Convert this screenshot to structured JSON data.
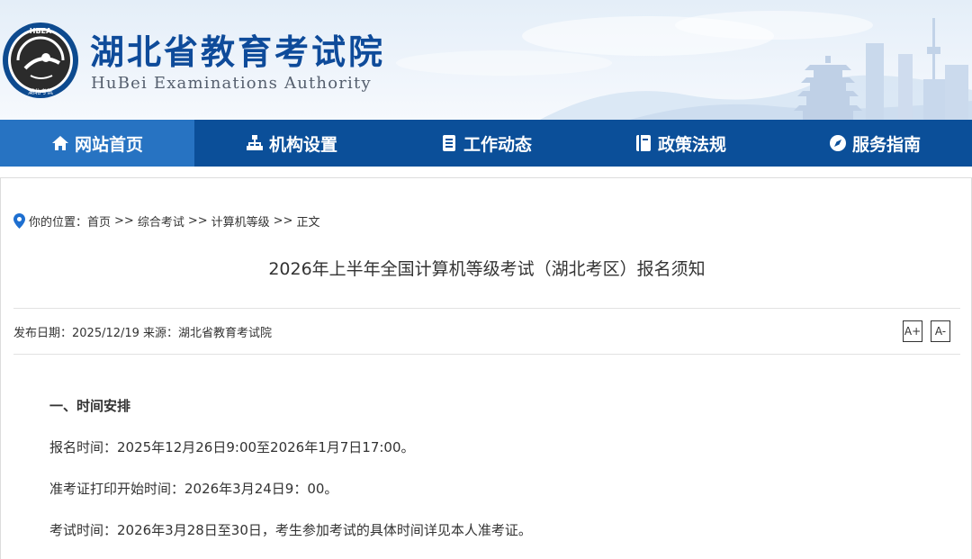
{
  "header": {
    "logo_text": "HBEA",
    "logo_subtext": "湖北考试",
    "title": "湖北省教育考试院",
    "subtitle": "HuBei Examinations Authority"
  },
  "nav": {
    "items": [
      {
        "label": "网站首页",
        "icon": "home-icon",
        "active": true
      },
      {
        "label": "机构设置",
        "icon": "org-chart-icon",
        "active": false
      },
      {
        "label": "工作动态",
        "icon": "news-icon",
        "active": false
      },
      {
        "label": "政策法规",
        "icon": "book-icon",
        "active": false
      },
      {
        "label": "服务指南",
        "icon": "compass-icon",
        "active": false
      }
    ]
  },
  "breadcrumb": {
    "prefix": "你的位置：",
    "items": [
      "首页",
      "综合考试",
      "计算机等级",
      "正文"
    ],
    "separator": ">>"
  },
  "article": {
    "title": "2026年上半年全国计算机等级考试（湖北考区）报名须知",
    "meta": "发布日期：2025/12/19 来源：湖北省教育考试院",
    "font_increase": "A+",
    "font_decrease": "A-",
    "section_heading": "一、时间安排",
    "paragraphs": [
      "报名时间：2025年12月26日9:00至2026年1月7日17:00。",
      "准考证打印开始时间：2026年3月24日9：00。",
      "考试时间：2026年3月28日至30日，考生参加考试的具体时间详见本人准考证。"
    ]
  },
  "colors": {
    "nav_bg": "#0b4f99",
    "nav_active": "#2773c2",
    "title_blue": "#0e4b9a",
    "pin_blue": "#1e6fd0"
  }
}
